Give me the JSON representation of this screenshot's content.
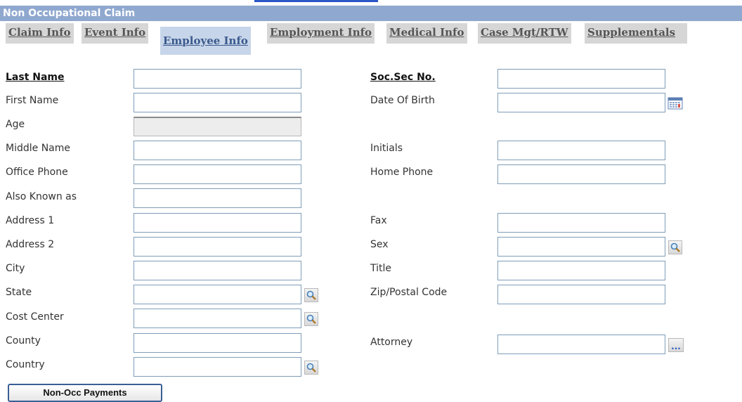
{
  "window": {
    "title": "Non Occupational Claim"
  },
  "tabs": [
    {
      "label": "Claim Info",
      "active": false
    },
    {
      "label": "Event Info",
      "active": false
    },
    {
      "label": "Employee Info",
      "active": true
    },
    {
      "label": "Employment Info",
      "active": false
    },
    {
      "label": "Medical Info",
      "active": false
    },
    {
      "label": "Case Mgt/RTW",
      "active": false
    },
    {
      "label": "Supplementals",
      "active": false
    }
  ],
  "left_fields": [
    {
      "label": "Last Name",
      "value": "",
      "required": true
    },
    {
      "label": "First Name",
      "value": ""
    },
    {
      "label": "Age",
      "value": "",
      "readonly": true
    },
    {
      "label": "Middle Name",
      "value": ""
    },
    {
      "label": "Office Phone",
      "value": ""
    },
    {
      "label": "Also Known as",
      "value": ""
    },
    {
      "label": "Address 1",
      "value": ""
    },
    {
      "label": "Address 2",
      "value": ""
    },
    {
      "label": "City",
      "value": ""
    },
    {
      "label": "State",
      "value": "",
      "icon": "search-icon"
    },
    {
      "label": "Cost Center",
      "value": "",
      "icon": "search-icon"
    },
    {
      "label": "County",
      "value": ""
    },
    {
      "label": "Country",
      "value": "",
      "icon": "search-icon"
    }
  ],
  "right_fields": [
    {
      "label": "Soc.Sec No.",
      "value": "",
      "required": true
    },
    {
      "label": "Date Of Birth",
      "value": "",
      "icon": "calendar-icon"
    },
    {
      "label": "Initials",
      "value": ""
    },
    {
      "label": "Home Phone",
      "value": ""
    },
    {
      "label": "Fax",
      "value": ""
    },
    {
      "label": "Sex",
      "value": "",
      "icon": "search-icon"
    },
    {
      "label": "Title",
      "value": ""
    },
    {
      "label": "Zip/Postal Code",
      "value": ""
    },
    {
      "label": "Attorney",
      "value": "",
      "icon": "ellipsis-icon"
    }
  ],
  "buttons": {
    "payments_label": "Non-Occ Payments"
  },
  "colors": {
    "title_bar": "#8fa8cf",
    "active_tab": "#c7d5ea",
    "inactive_tab": "#d6d6d6",
    "field_border": "#7f9db9"
  }
}
